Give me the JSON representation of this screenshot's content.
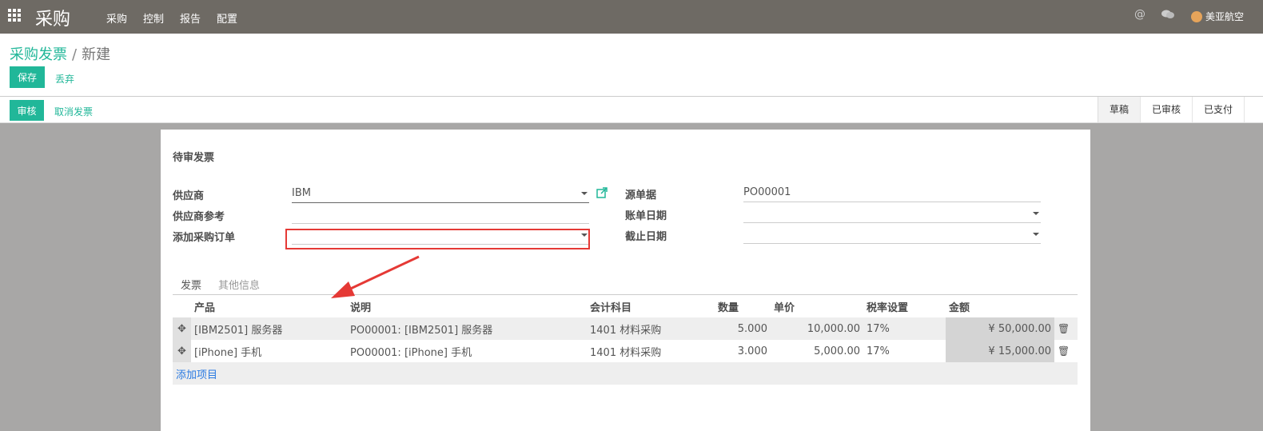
{
  "topbar": {
    "app_title": "采购",
    "menu": [
      "采购",
      "控制",
      "报告",
      "配置"
    ],
    "user_name": "美亚航空",
    "at_symbol": "@"
  },
  "breadcrumb": {
    "parent": "采购发票",
    "separator": "/",
    "current": "新建"
  },
  "actions": {
    "save": "保存",
    "discard": "丢弃"
  },
  "statusbar": {
    "approve": "审核",
    "cancel": "取消发票",
    "states": [
      "草稿",
      "已审核",
      "已支付"
    ]
  },
  "form": {
    "status_title": "待审发票",
    "supplier_label": "供应商",
    "supplier_value": "IBM",
    "supplier_ref_label": "供应商参考",
    "supplier_ref_value": "",
    "add_po_label": "添加采购订单",
    "add_po_value": "",
    "source_doc_label": "源单据",
    "source_doc_value": "PO00001",
    "bill_date_label": "账单日期",
    "bill_date_value": "",
    "due_date_label": "截止日期",
    "due_date_value": ""
  },
  "tabs": [
    "发票",
    "其他信息"
  ],
  "table": {
    "headers": [
      "产品",
      "说明",
      "会计科目",
      "数量",
      "单价",
      "税率设置",
      "金额"
    ],
    "rows": [
      [
        "[IBM2501] 服务器",
        "PO00001: [IBM2501] 服务器",
        "1401 材料采购",
        "5.000",
        "10,000.00",
        "17%",
        "¥ 50,000.00"
      ],
      [
        "[iPhone] 手机",
        "PO00001: [iPhone] 手机",
        "1401 材料采购",
        "3.000",
        "5,000.00",
        "17%",
        "¥ 15,000.00"
      ]
    ],
    "add_item": "添加项目"
  },
  "colors": {
    "accent": "#21b799",
    "topbar": "#6e6a64",
    "highlight": "#e53935"
  }
}
